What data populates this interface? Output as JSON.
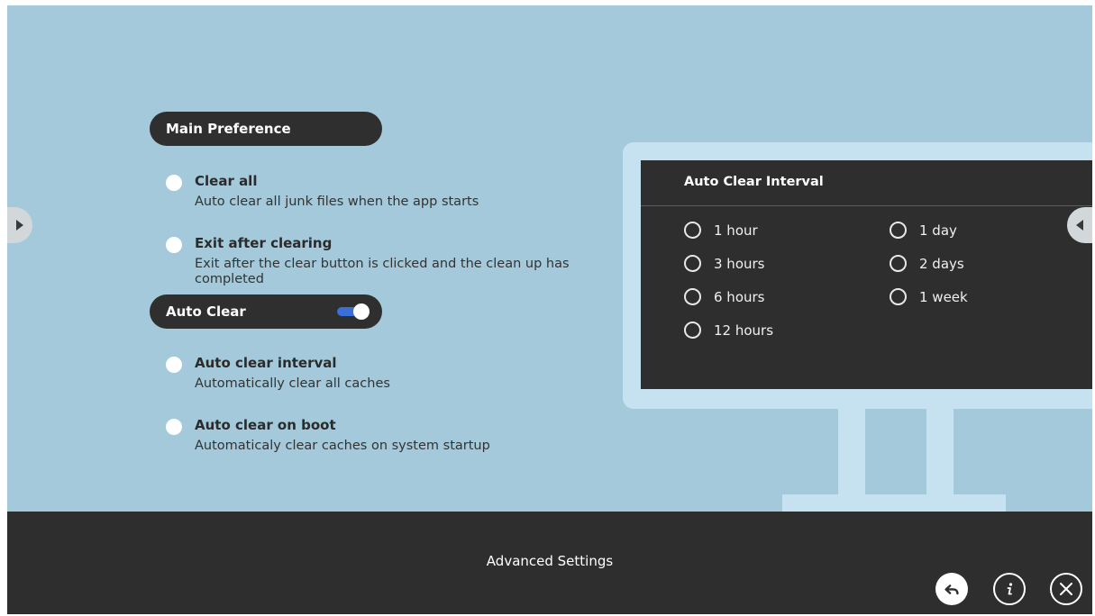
{
  "main_preference": {
    "header": "Main Preference",
    "options": [
      {
        "title": "Clear all",
        "description": "Auto clear all junk files when the app starts"
      },
      {
        "title": "Exit after clearing",
        "description": "Exit after the clear button is clicked and the clean up has completed"
      }
    ]
  },
  "auto_clear": {
    "header": "Auto Clear",
    "toggle_on": true,
    "options": [
      {
        "title": "Auto clear interval",
        "description": "Automatically clear all caches"
      },
      {
        "title": "Auto clear on boot",
        "description": "Automaticaly clear caches on system startup"
      }
    ]
  },
  "interval_panel": {
    "title": "Auto Clear Interval",
    "left_options": [
      "1 hour",
      "3 hours",
      "6 hours",
      "12 hours"
    ],
    "right_options": [
      "1 day",
      "2 days",
      "1 week"
    ]
  },
  "footer": {
    "title": "Advanced Settings",
    "buttons": [
      "back-icon",
      "info-icon",
      "close-icon"
    ]
  },
  "colors": {
    "background": "#a3c9da",
    "dark": "#2e2e2e",
    "toggle_accent": "#3a6fd8",
    "monitor_frame": "#c6e2f1"
  }
}
